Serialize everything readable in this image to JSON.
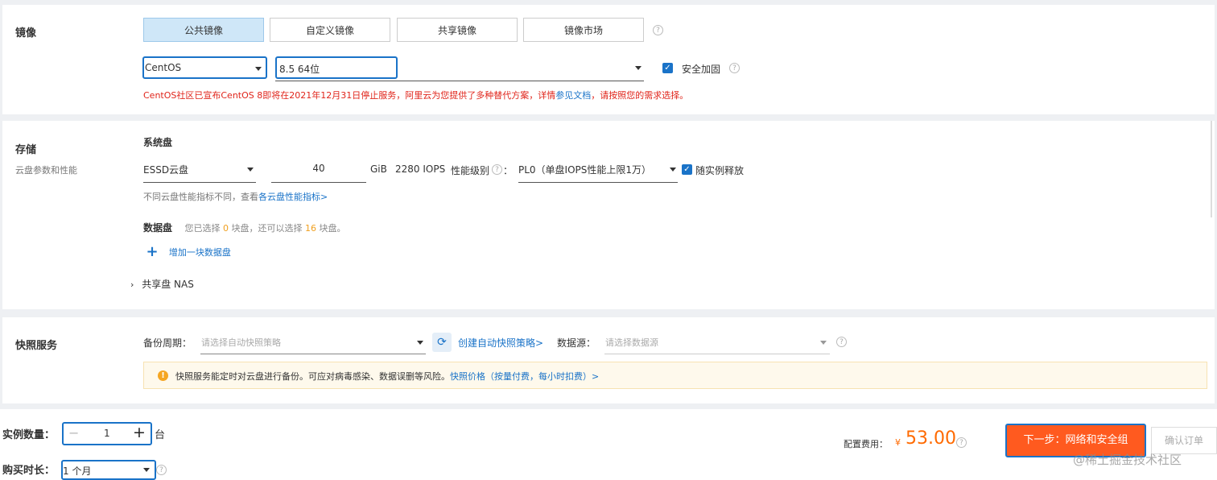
{
  "image": {
    "title": "镜像",
    "tabs": [
      "公共镜像",
      "自定义镜像",
      "共享镜像",
      "镜像市场"
    ],
    "active_tab": 0,
    "os_select": "CentOS",
    "version_select": "8.5 64位",
    "security_label": "安全加固",
    "notice_prefix": "CentOS社区已宣布CentOS 8即将在2021年12月31日停止服务，阿里云为您提供了多种替代方案，详情",
    "notice_link": "参见文档",
    "notice_suffix": "，请按照您的需求选择。"
  },
  "storage": {
    "title": "存储",
    "subtitle": "云盘参数和性能",
    "system_disk_label": "系统盘",
    "disk_type": "ESSD云盘",
    "size": "40",
    "unit": "GiB",
    "iops": "2280 IOPS",
    "perf_label": "性能级别",
    "perf_colon": "：",
    "perf_level": "PL0（单盘IOPS性能上限1万）",
    "release_label": "随实例释放",
    "hint_text": "不同云盘性能指标不同，查看",
    "hint_link": "各云盘性能指标>",
    "data_disk_label": "数据盘",
    "data_disk_pre": "您已选择",
    "data_disk_selected": "0",
    "data_disk_mid": "块盘，还可以选择",
    "data_disk_remaining": "16",
    "data_disk_post": "块盘。",
    "add_disk": "增加一块数据盘",
    "nas_label": "共享盘 NAS"
  },
  "snapshot": {
    "title": "快照服务",
    "period_label": "备份周期：",
    "period_placeholder": "请选择自动快照策略",
    "create_link": "创建自动快照策略>",
    "source_label": "数据源：",
    "source_placeholder": "请选择数据源",
    "info_text": "快照服务能定时对云盘进行备份。可应对病毒感染、数据误删等风险。",
    "info_link": "快照价格（按量付费，每小时扣费）>"
  },
  "footer": {
    "qty_label": "实例数量：",
    "qty_value": "1",
    "qty_unit": "台",
    "duration_label": "购买时长：",
    "duration_value": "1 个月",
    "cost_label": "配置费用：",
    "currency": "¥",
    "cost_value": "53.00",
    "next_button": "下一步：网络和安全组",
    "confirm_button": "确认订单",
    "watermark": "@稀土掘金技术社区"
  },
  "colors": {
    "accent": "#1a73c8",
    "warning": "#e0241a",
    "price": "#ff6a00",
    "next_button_bg": "#ff5a1f"
  }
}
